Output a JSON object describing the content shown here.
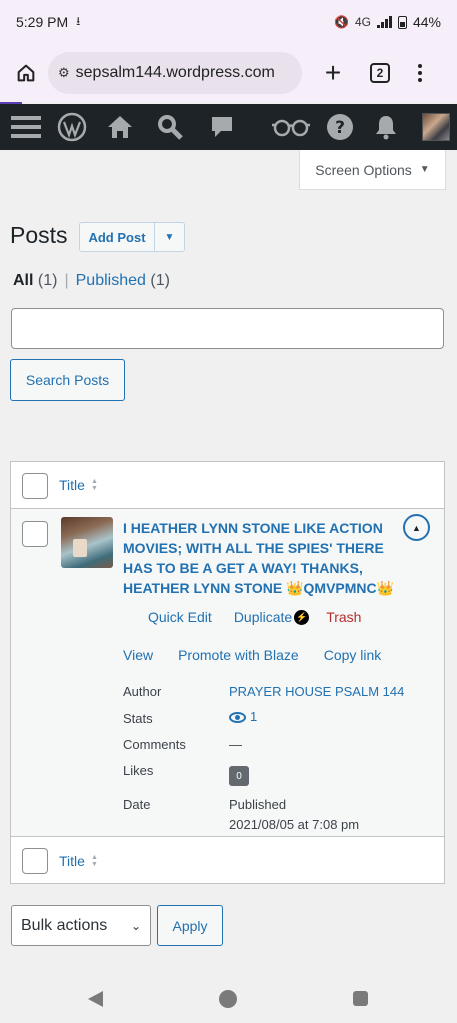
{
  "status": {
    "time": "5:29 PM",
    "network": "4G",
    "battery": "44%"
  },
  "browser": {
    "url": "sepsalm144.wordpress.com",
    "tab_count": "2"
  },
  "screen_options": {
    "label": "Screen Options"
  },
  "page": {
    "title": "Posts",
    "add_post_label": "Add Post"
  },
  "filters": {
    "all_label": "All",
    "all_count": "(1)",
    "separator": "|",
    "published_label": "Published",
    "published_count": "(1)"
  },
  "search": {
    "value": "",
    "placeholder": "",
    "button_label": "Search Posts"
  },
  "table": {
    "column_title": "Title",
    "rows": [
      {
        "title": "I HEATHER LYNN STONE LIKE ACTION MOVIES; WITH ALL THE SPIES' THERE HAS TO BE A GET A WAY! THANKS, HEATHER LYNN STONE 👑QMVPMNC👑",
        "actions": {
          "quick_edit": "Quick Edit",
          "duplicate": "Duplicate",
          "trash": "Trash",
          "view": "View",
          "promote": "Promote with Blaze",
          "copy_link": "Copy link"
        },
        "meta": {
          "author_label": "Author",
          "author": "PRAYER HOUSE PSALM 144",
          "stats_label": "Stats",
          "stats": "1",
          "comments_label": "Comments",
          "comments": "—",
          "likes_label": "Likes",
          "likes": "0",
          "date_label": "Date",
          "date_status": "Published",
          "date": "2021/08/05 at 7:08 pm"
        }
      }
    ]
  },
  "bulk": {
    "selected": "Bulk actions",
    "apply_label": "Apply"
  },
  "colors": {
    "accent": "#2271b1",
    "admin_bar": "#1d2327",
    "trash": "#b32d2e"
  }
}
